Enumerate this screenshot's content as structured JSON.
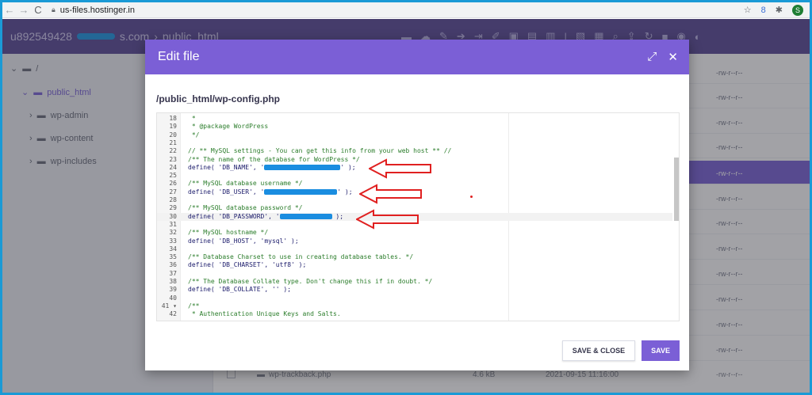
{
  "browser": {
    "url": "us-files.hostinger.in",
    "back": "←",
    "forward": "→",
    "reload": "C",
    "avatar_letter": "S",
    "star": "☆",
    "ext_icon": "8",
    "puzzle": "✱"
  },
  "file_manager": {
    "account": "u892549428",
    "account_suffix": "s.com",
    "separator": "›",
    "current_folder": "public_html",
    "toolbar_icons": [
      "folder-icon",
      "cloud-icon",
      "edit-icon",
      "move-icon",
      "export-icon",
      "pencil-icon",
      "lock-icon",
      "grid-icon",
      "trash-icon",
      "divider",
      "file-icon",
      "folder-plus-icon",
      "search-icon",
      "upload-icon",
      "refresh-icon",
      "apps-icon",
      "globe-icon"
    ]
  },
  "sidebar": {
    "root": "/",
    "items": [
      {
        "label": "public_html",
        "expanded": true
      },
      {
        "label": "wp-admin"
      },
      {
        "label": "wp-content"
      },
      {
        "label": "wp-includes"
      }
    ]
  },
  "file_list": {
    "permissions": [
      "-rw-r--r--",
      "-rw-r--r--",
      "-rw-r--r--",
      "-rw-r--r--",
      "-rw-r--r--",
      "-rw-r--r--",
      "-rw-r--r--",
      "-rw-r--r--",
      "-rw-r--r--",
      "-rw-r--r--",
      "-rw-r--r--",
      "-rw-r--r--",
      "-rw-r--r--"
    ],
    "bottom_file": {
      "name": "wp-trackback.php",
      "size": "4.6 kB",
      "date": "2021-09-15 11:16:00",
      "perm": "-rw-r--r--"
    }
  },
  "modal": {
    "title": "Edit file",
    "path": "/public_html/wp-config.php",
    "save_close_label": "SAVE & CLOSE",
    "save_label": "SAVE"
  },
  "code_lines": [
    {
      "n": "18",
      "t": " *",
      "c": "comment"
    },
    {
      "n": "19",
      "t": " * @package WordPress",
      "c": "comment"
    },
    {
      "n": "20",
      "t": " */",
      "c": "comment"
    },
    {
      "n": "21",
      "t": "",
      "c": ""
    },
    {
      "n": "22",
      "t": "// ** MySQL settings - You can get this info from your web host ** //",
      "c": "comment"
    },
    {
      "n": "23",
      "t": "/** The name of the database for WordPress */",
      "c": "comment"
    },
    {
      "n": "24",
      "t": "define( 'DB_NAME', '",
      "c": "",
      "after": "' );"
    },
    {
      "n": "25",
      "t": "",
      "c": ""
    },
    {
      "n": "26",
      "t": "/** MySQL database username */",
      "c": "comment"
    },
    {
      "n": "27",
      "t": "define( 'DB_USER', '",
      "c": "",
      "after": "' );"
    },
    {
      "n": "28",
      "t": "",
      "c": ""
    },
    {
      "n": "29",
      "t": "/** MySQL database password */",
      "c": "comment"
    },
    {
      "n": "30",
      "t": "define( 'DB_PASSWORD', '",
      "c": "",
      "after": " );"
    },
    {
      "n": "31",
      "t": "",
      "c": ""
    },
    {
      "n": "32",
      "t": "/** MySQL hostname */",
      "c": "comment"
    },
    {
      "n": "33",
      "t": "define( 'DB_HOST', 'mysql' );",
      "c": ""
    },
    {
      "n": "34",
      "t": "",
      "c": ""
    },
    {
      "n": "35",
      "t": "/** Database Charset to use in creating database tables. */",
      "c": "comment"
    },
    {
      "n": "36",
      "t": "define( 'DB_CHARSET', 'utf8' );",
      "c": ""
    },
    {
      "n": "37",
      "t": "",
      "c": ""
    },
    {
      "n": "38",
      "t": "/** The Database Collate type. Don't change this if in doubt. */",
      "c": "comment"
    },
    {
      "n": "39",
      "t": "define( 'DB_COLLATE', '' );",
      "c": ""
    },
    {
      "n": "40",
      "t": "",
      "c": ""
    },
    {
      "n": "41 ▾",
      "t": "/**",
      "c": "comment"
    },
    {
      "n": "42",
      "t": " * Authentication Unique Keys and Salts.",
      "c": "comment"
    }
  ],
  "colors": {
    "accent": "#7b5fd6",
    "header": "#4d3d8f",
    "redaction": "#1a8de0",
    "arrow": "#e02020"
  }
}
